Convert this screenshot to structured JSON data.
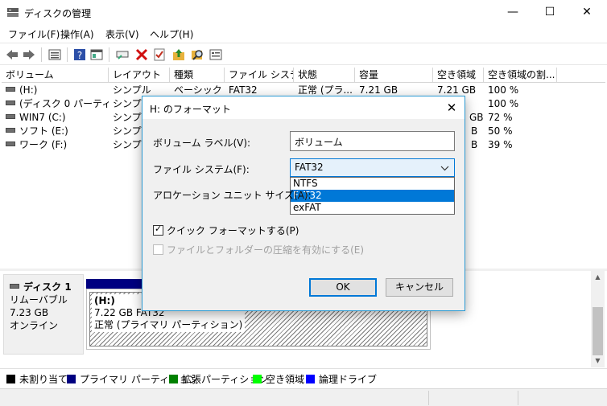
{
  "window": {
    "title": "ディスクの管理",
    "minimize": "—",
    "maximize": "☐",
    "close": "✕",
    "icon": "disk-management-icon"
  },
  "menu": [
    "ファイル(F)",
    "操作(A)",
    "表示(V)",
    "ヘルプ(H)"
  ],
  "toolbar": [
    "back-arrow-icon",
    "forward-arrow-icon",
    "list-view-icon",
    "help-icon",
    "properties-icon",
    "connect-icon",
    "delete-icon",
    "check-icon",
    "up-folder-icon",
    "search-icon",
    "console-icon"
  ],
  "volume_table": {
    "headers": [
      "ボリューム",
      "レイアウト",
      "種類",
      "ファイル システム",
      "状態",
      "容量",
      "空き領域",
      "空き領域の割..."
    ],
    "rows": [
      [
        "(H:)",
        "シンプル",
        "ベーシック",
        "FAT32",
        "正常 (プラ...",
        "7.21 GB",
        "7.21 GB",
        "100 %"
      ],
      [
        "(ディスク 0 パーティシ...",
        "シンプル",
        "",
        "",
        "",
        "",
        "",
        "100 %"
      ],
      [
        "WIN7 (C:)",
        "シンプル",
        "",
        "",
        "",
        "",
        "GB",
        "72 %"
      ],
      [
        "ソフト (E:)",
        "シンプル",
        "",
        "",
        "",
        "",
        "B",
        "50 %"
      ],
      [
        "ワーク (F:)",
        "シンプル",
        "",
        "",
        "",
        "",
        "B",
        "39 %"
      ]
    ]
  },
  "disk": {
    "name": "ディスク 1",
    "type": "リムーバブル",
    "size": "7.23 GB",
    "status": "オンライン",
    "partition": {
      "label": "(H:)",
      "size_fs": "7.22 GB FAT32",
      "status": "正常 (プライマリ パーティション)"
    }
  },
  "legend": [
    {
      "label": "未割り当て",
      "color": "#000000"
    },
    {
      "label": "プライマリ パーティション",
      "color": "#000080"
    },
    {
      "label": "拡張パーティション",
      "color": "#008000"
    },
    {
      "label": "空き領域",
      "color": "#00ff00"
    },
    {
      "label": "論理ドライブ",
      "color": "#0000ff"
    }
  ],
  "dialog": {
    "title": "H: のフォーマット",
    "close": "✕",
    "volume_label_label": "ボリューム ラベル(V):",
    "volume_label_value": "ボリューム",
    "fs_label": "ファイル システム(F):",
    "fs_selected": "FAT32",
    "fs_options": [
      "NTFS",
      "FAT32",
      "exFAT"
    ],
    "fs_highlighted": "FAT32",
    "alloc_label": "アロケーション ユニット サイズ(A):",
    "quick_format_label": "クイック フォーマットする(P)",
    "quick_format_checked": true,
    "compress_label": "ファイルとフォルダーの圧縮を有効にする(E)",
    "compress_checked": false,
    "ok": "OK",
    "cancel": "キャンセル"
  }
}
